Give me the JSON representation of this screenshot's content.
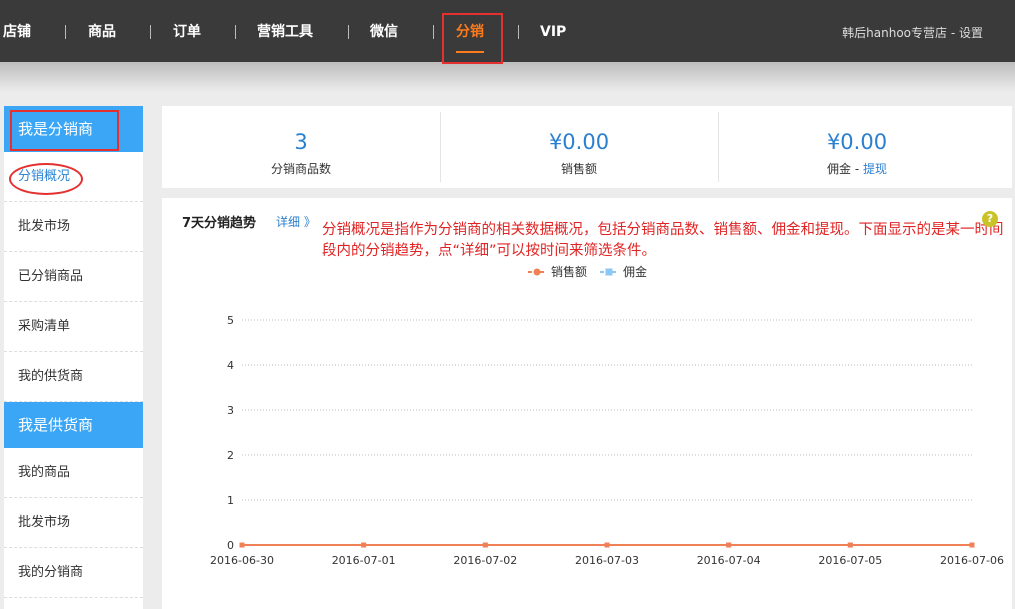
{
  "nav": {
    "items": [
      "店铺",
      "商品",
      "订单",
      "营销工具",
      "微信",
      "分销",
      "VIP"
    ],
    "active_index": 5,
    "account_name": "韩后hanhoo专营店",
    "account_sep": " - ",
    "settings_label": "设置"
  },
  "sidebar": {
    "distributor_heading": "我是分销商",
    "distributor_items": [
      "分销概况",
      "批发市场",
      "已分销商品",
      "采购清单",
      "我的供货商"
    ],
    "active_item": "分销概况",
    "supplier_heading": "我是供货商",
    "supplier_items": [
      "我的商品",
      "批发市场",
      "我的分销商"
    ]
  },
  "stats": [
    {
      "value": "3",
      "label": "分销商品数"
    },
    {
      "value": "¥0.00",
      "label": "销售额"
    },
    {
      "value": "¥0.00",
      "label": "佣金 - ",
      "link": "提现"
    }
  ],
  "chart_section": {
    "title": "7天分销趋势",
    "detail_link": "详细 》",
    "annotation": "分销概况是指作为分销商的相关数据概况，包括分销商品数、销售额、佣金和提现。下面显示的是某一时间段内的分销趋势，点“详细”可以按时间来筛选条件。",
    "help_icon": "?"
  },
  "chart_data": {
    "type": "line",
    "categories": [
      "2016-06-30",
      "2016-07-01",
      "2016-07-02",
      "2016-07-03",
      "2016-07-04",
      "2016-07-05",
      "2016-07-06"
    ],
    "series": [
      {
        "name": "销售额",
        "values": [
          0,
          0,
          0,
          0,
          0,
          0,
          0
        ],
        "color": "#f08156"
      },
      {
        "name": "佣金",
        "values": [
          0,
          0,
          0,
          0,
          0,
          0,
          0
        ],
        "color": "#8cc8f5"
      }
    ],
    "ylim": [
      0,
      5
    ],
    "yticks": [
      0,
      1,
      2,
      3,
      4,
      5
    ],
    "grid": true,
    "legend": "top-center"
  }
}
